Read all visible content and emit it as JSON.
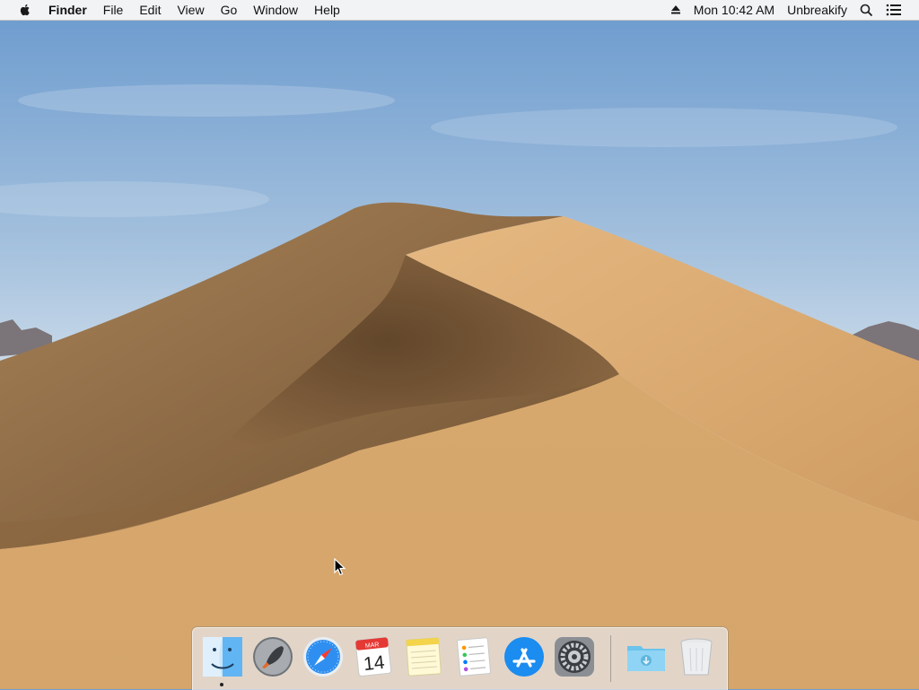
{
  "menubar": {
    "apple_icon": "apple-icon",
    "app_name": "Finder",
    "menus": [
      "File",
      "Edit",
      "View",
      "Go",
      "Window",
      "Help"
    ],
    "status": {
      "eject_icon": "eject-icon",
      "clock": "Mon 10:42 AM",
      "user": "Unbreakify",
      "search_icon": "spotlight-search-icon",
      "notifications_icon": "notification-center-icon"
    }
  },
  "dock": {
    "apps": [
      {
        "name": "Finder",
        "icon": "finder-icon",
        "running": true
      },
      {
        "name": "Launchpad",
        "icon": "launchpad-icon"
      },
      {
        "name": "Safari",
        "icon": "safari-icon"
      },
      {
        "name": "Calendar",
        "icon": "calendar-icon",
        "month": "MAR",
        "day": "14"
      },
      {
        "name": "Notes",
        "icon": "notes-icon"
      },
      {
        "name": "Reminders",
        "icon": "reminders-icon"
      },
      {
        "name": "App Store",
        "icon": "app-store-icon"
      },
      {
        "name": "System Preferences",
        "icon": "system-preferences-icon"
      }
    ],
    "stacks": [
      {
        "name": "Downloads",
        "icon": "downloads-folder-icon"
      },
      {
        "name": "Trash",
        "icon": "trash-icon"
      }
    ]
  },
  "colors": {
    "sky_top": "#6e9ed0",
    "sky_bottom": "#e8eef3",
    "sand_light": "#d9ad75",
    "sand_dark": "#7d5a35"
  }
}
